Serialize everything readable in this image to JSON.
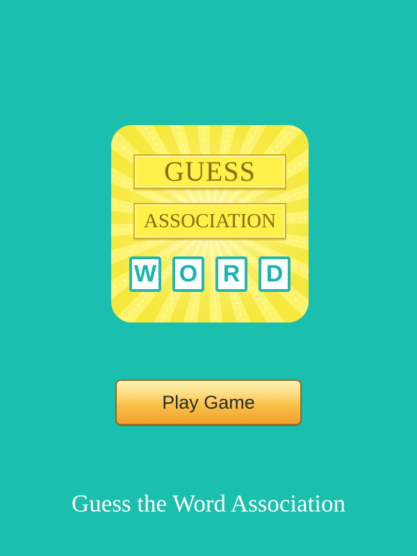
{
  "app": {
    "title": "Guess the Word Association"
  },
  "logo": {
    "line1": "GUESS",
    "line2": "ASSOCIATION",
    "tiles": [
      "W",
      "O",
      "R",
      "D"
    ]
  },
  "play_button": {
    "label": "Play Game"
  },
  "colors": {
    "background": "#1bbfad",
    "logo_yellow": "#fdf46b",
    "tile_teal": "#19b4b1",
    "plate_text": "#8c6b12",
    "button_top": "#fff3b2",
    "button_bottom": "#f0a02a"
  }
}
